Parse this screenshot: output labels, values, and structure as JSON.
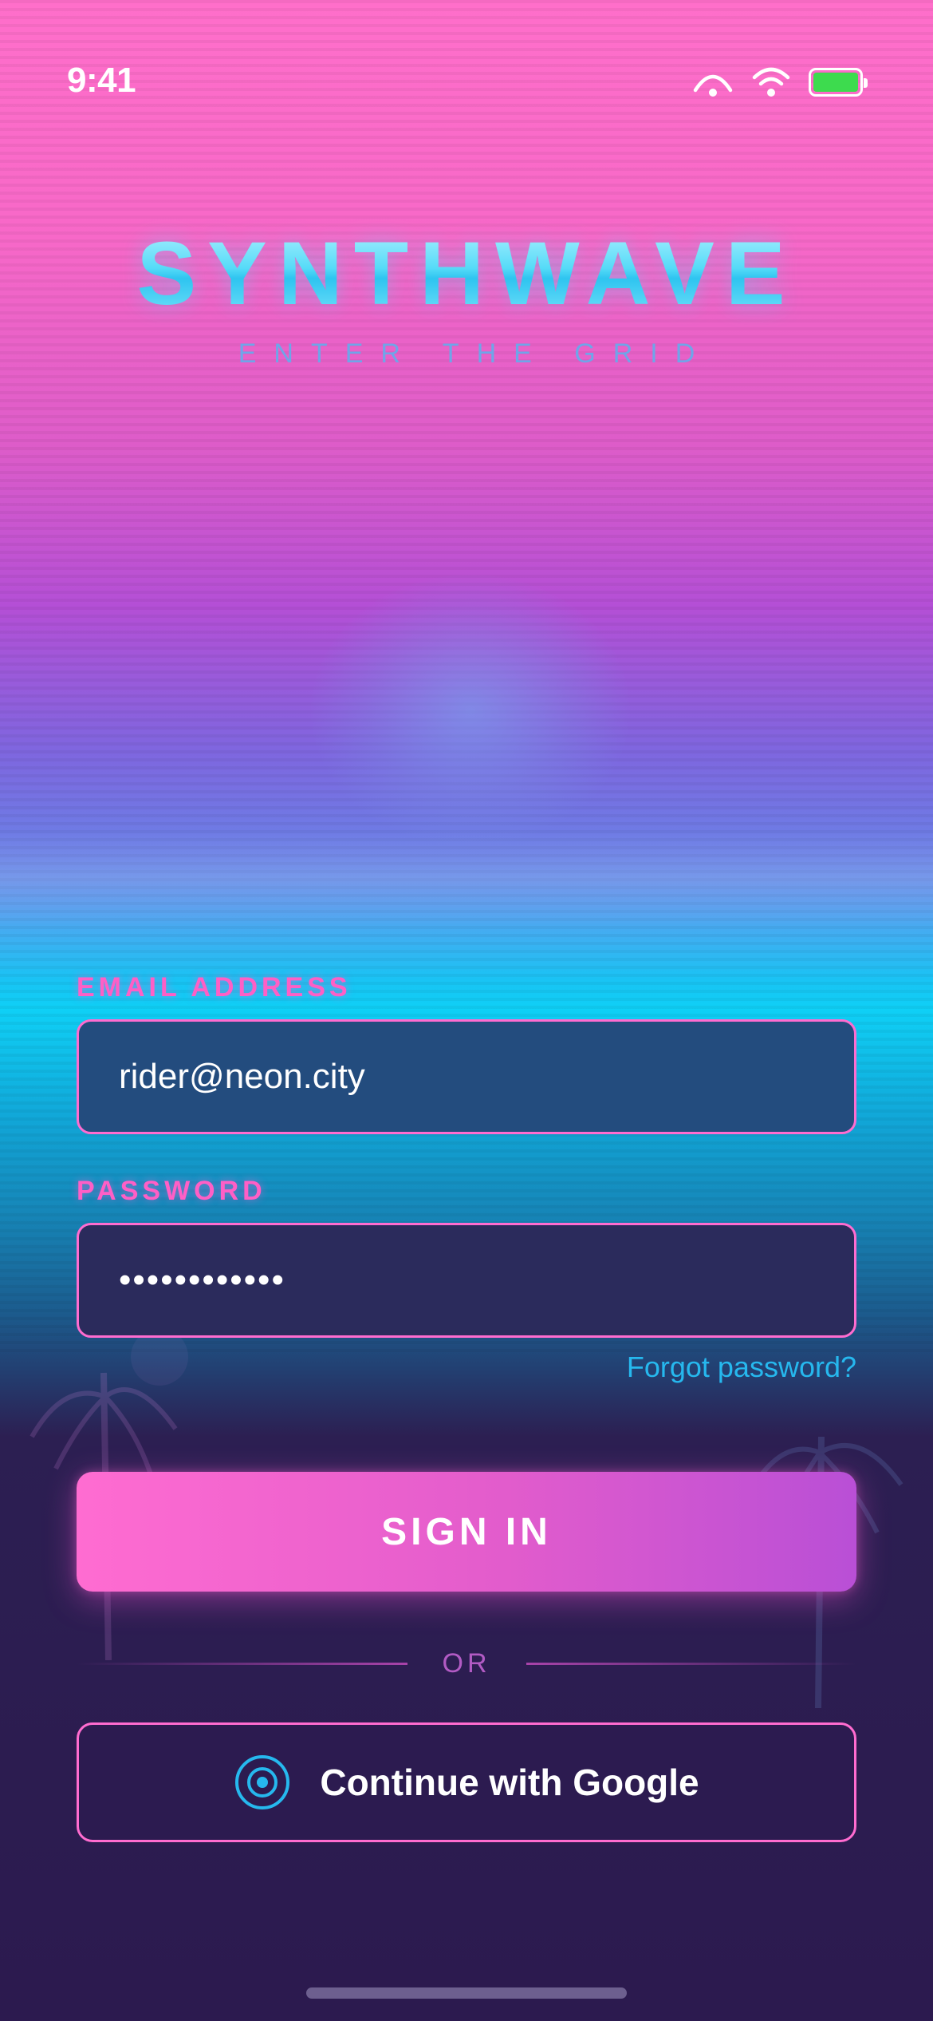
{
  "status_bar": {
    "time": "9:41",
    "icons": [
      "signal-arc-icon",
      "wifi-icon",
      "battery-icon"
    ],
    "battery_color": "#3ddb4e"
  },
  "header": {
    "title": "SYNTHWAVE",
    "subtitle": "ENTER THE GRID"
  },
  "form": {
    "email_label": "EMAIL ADDRESS",
    "email_value": "rider@neon.city",
    "password_label": "PASSWORD",
    "password_value": "••••••••••••",
    "forgot_link": "Forgot password?"
  },
  "actions": {
    "sign_in_label": "SIGN IN",
    "divider_text": "OR",
    "google_label": "Continue with Google",
    "google_icon": "radio-target-icon"
  },
  "colors": {
    "accent_pink": "#ff6cd0",
    "accent_cyan": "#26b8ee",
    "background_dark": "#2c1a4f"
  }
}
